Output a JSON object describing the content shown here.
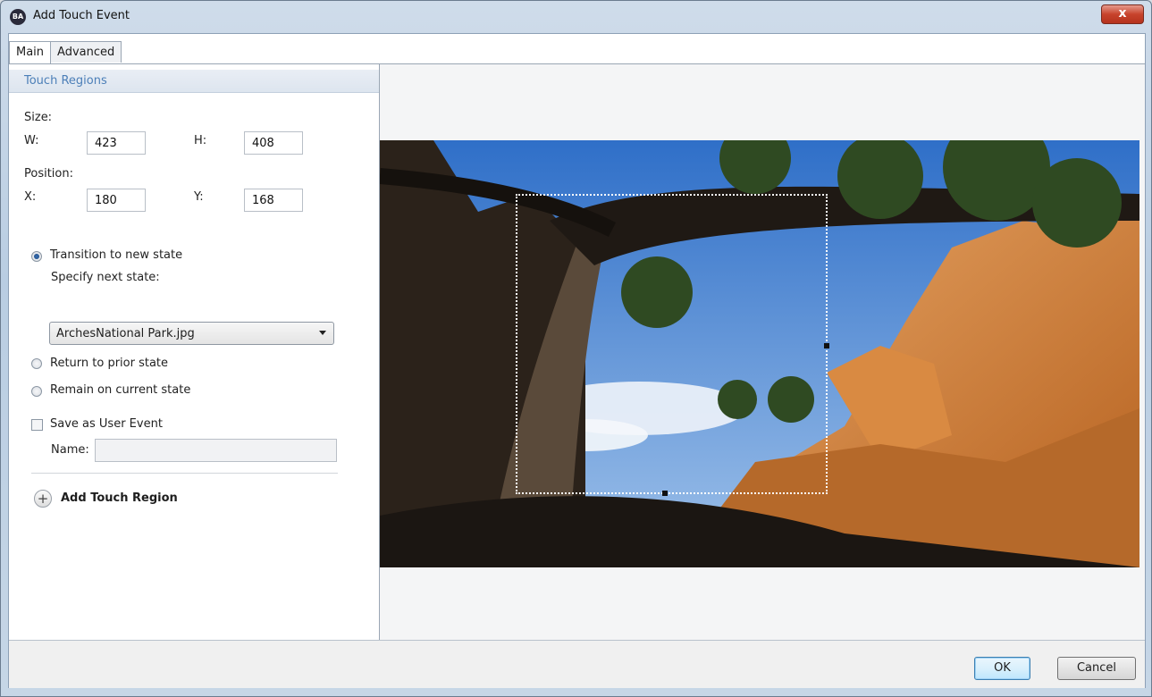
{
  "window": {
    "title": "Add Touch Event",
    "app_icon_text": "BA",
    "close_label": "x"
  },
  "tabs": [
    {
      "label": "Main",
      "active": true
    },
    {
      "label": "Advanced",
      "active": false
    }
  ],
  "section": {
    "title": "Touch Regions"
  },
  "size": {
    "label": "Size:",
    "w_label": "W:",
    "w_value": "423",
    "h_label": "H:",
    "h_value": "408"
  },
  "position": {
    "label": "Position:",
    "x_label": "X:",
    "x_value": "180",
    "y_label": "Y:",
    "y_value": "168"
  },
  "options": {
    "transition_label": "Transition to new state",
    "specify_label": "Specify next state:",
    "next_state_value": "ArchesNational Park.jpg",
    "return_label": "Return to prior state",
    "remain_label": "Remain on current state",
    "save_user_event_label": "Save as User Event",
    "name_label": "Name:",
    "name_value": "",
    "selected": "transition",
    "save_user_event_checked": false
  },
  "add_region_label": "Add Touch Region",
  "buttons": {
    "ok": "OK",
    "cancel": "Cancel"
  },
  "colors": {
    "accent": "#4c7fb8",
    "sky": "#3f7fd0",
    "rock": "#c8772e"
  }
}
